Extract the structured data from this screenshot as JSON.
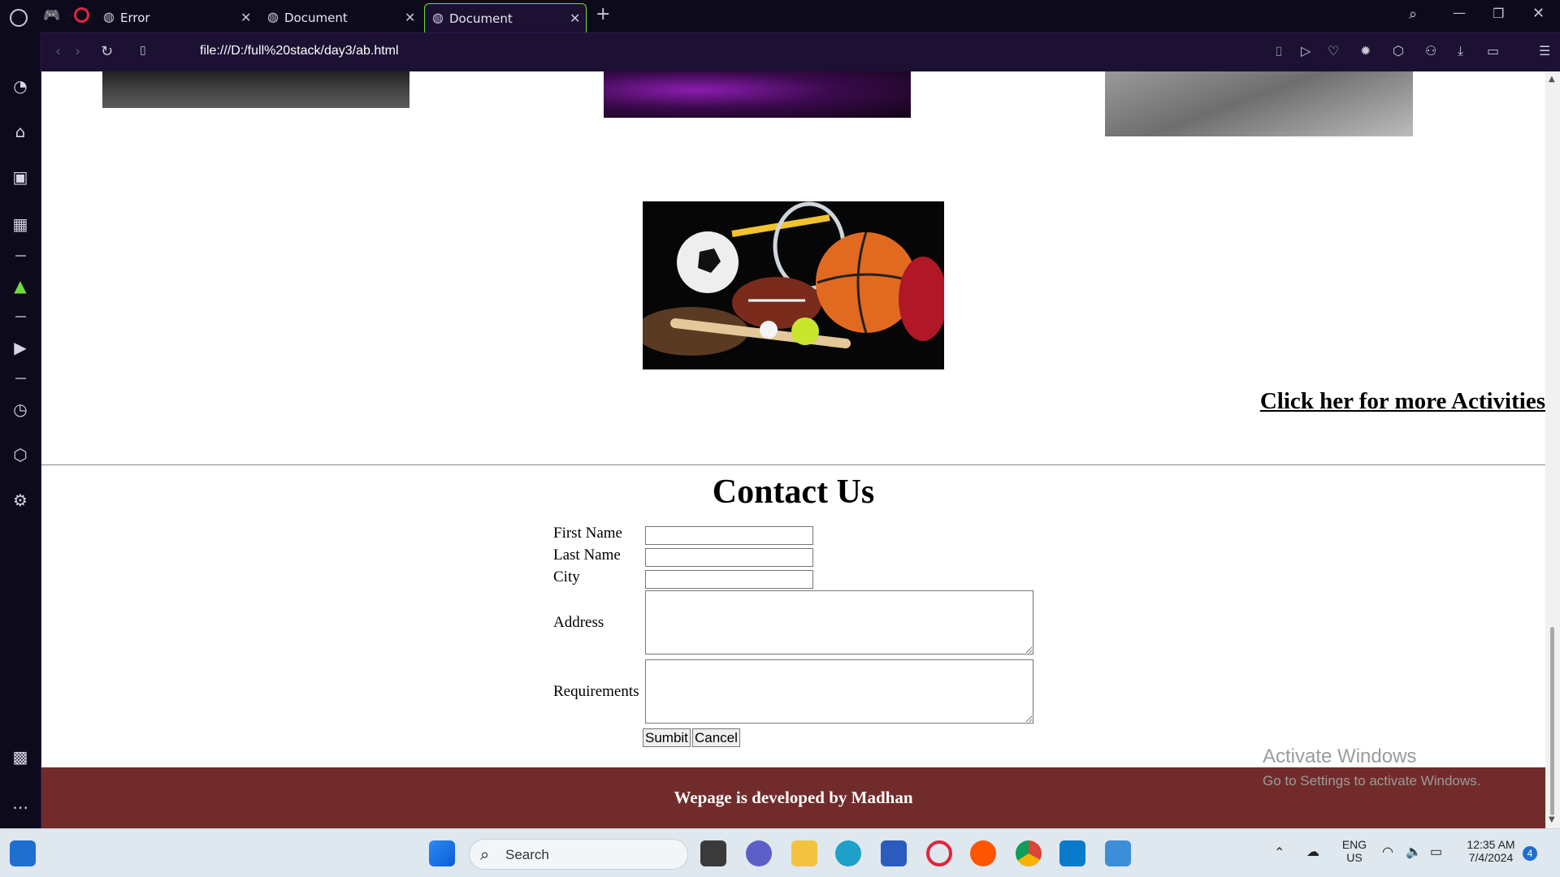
{
  "browser": {
    "tabs": [
      {
        "label": "Error",
        "icon": "globe-icon",
        "active": false
      },
      {
        "label": "Document",
        "icon": "globe-icon",
        "active": false
      },
      {
        "label": "Document",
        "icon": "globe-icon",
        "active": true
      }
    ],
    "new_tab_icon": "+",
    "close_icon": "✕",
    "url": "file:///D:/full%20stack/day3/ab.html"
  },
  "page": {
    "more_link": "Click her for more Activities",
    "contact_title": "Contact Us",
    "form": {
      "first_name_label": "First Name",
      "last_name_label": "Last Name",
      "city_label": "City",
      "address_label": "Address",
      "requirements_label": "Requirements",
      "submit_label": "Sumbit",
      "cancel_label": "Cancel"
    },
    "footer_text": "Wepage is developed by Madhan",
    "footer_color": "#722b2b"
  },
  "watermark": {
    "line1": "Activate Windows",
    "line2": "Go to Settings to activate Windows."
  },
  "taskbar": {
    "search_placeholder": "Search",
    "language": "ENG",
    "region": "US",
    "time": "12:35 AM",
    "date": "7/4/2024",
    "notification_count": "4"
  },
  "colors": {
    "browser_accent": "#6fdc3c",
    "browser_bg": "#0d0a1c"
  }
}
